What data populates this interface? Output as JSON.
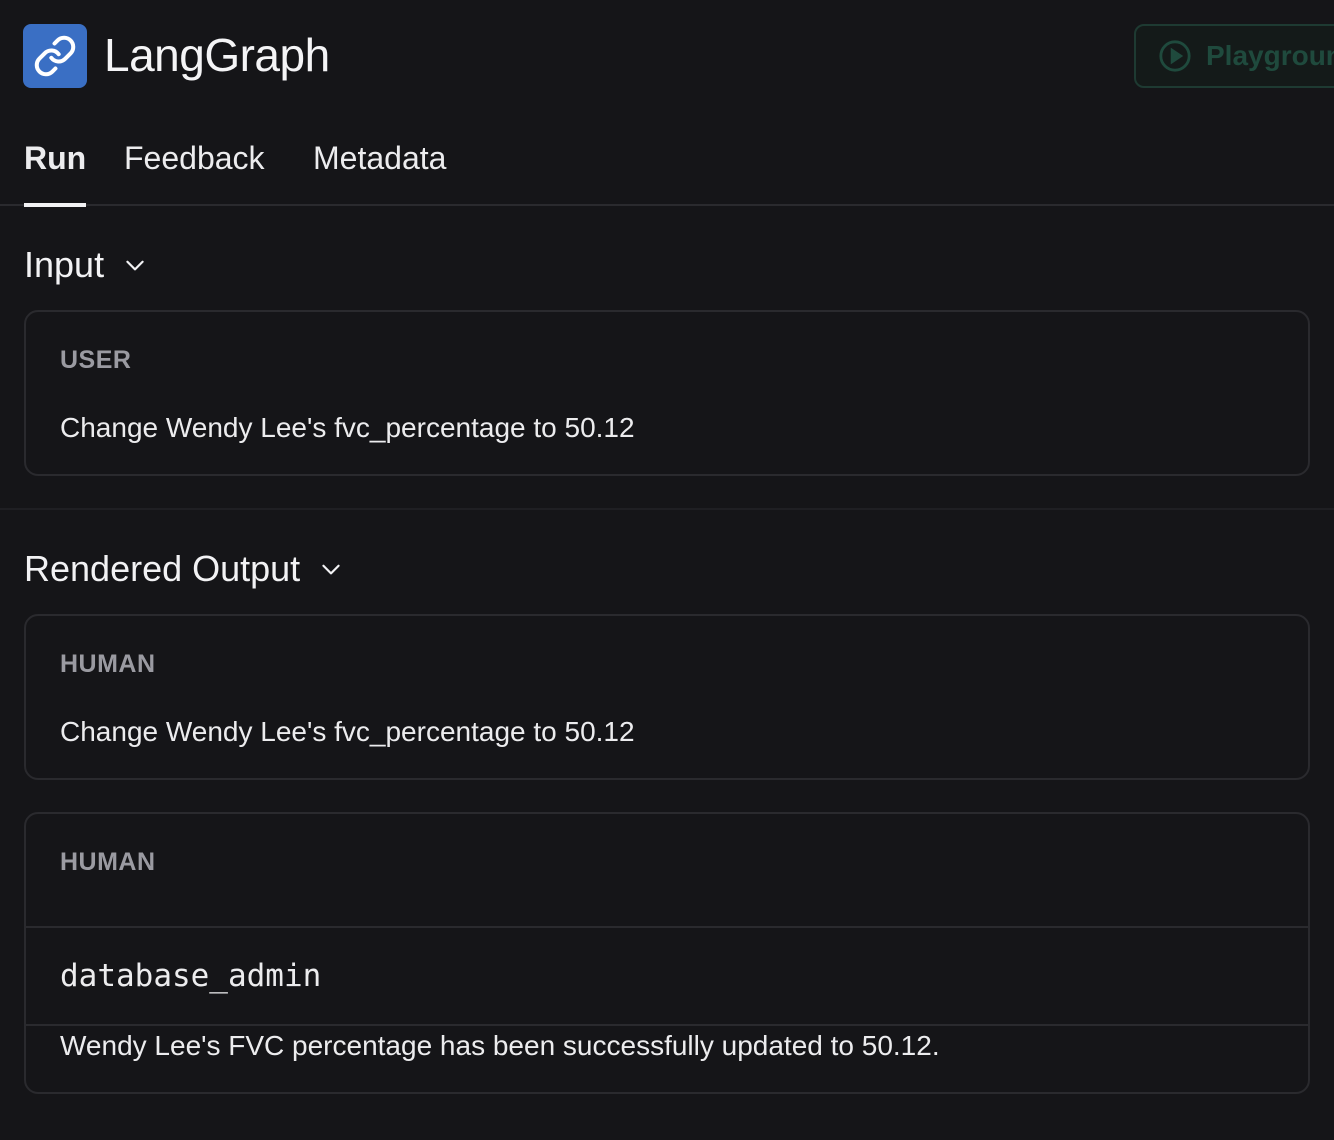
{
  "app": {
    "title": "LangGraph",
    "playground_label": "Playground"
  },
  "tabs": [
    {
      "label": "Run",
      "active": true
    },
    {
      "label": "Feedback",
      "active": false
    },
    {
      "label": "Metadata",
      "active": false
    }
  ],
  "input": {
    "title": "Input",
    "role": "USER",
    "message": "Change Wendy Lee's fvc_percentage to 50.12"
  },
  "output": {
    "title": "Rendered Output",
    "messages": [
      {
        "role": "HUMAN",
        "text": "Change Wendy Lee's fvc_percentage to 50.12"
      },
      {
        "role": "HUMAN",
        "tool_name": "database_admin",
        "text": "Wendy Lee's FVC percentage has been successfully updated to 50.12."
      }
    ]
  },
  "colors": {
    "background": "#151518",
    "logo_bg": "#3a6fc4",
    "playground_accent": "#1f4a3d"
  }
}
